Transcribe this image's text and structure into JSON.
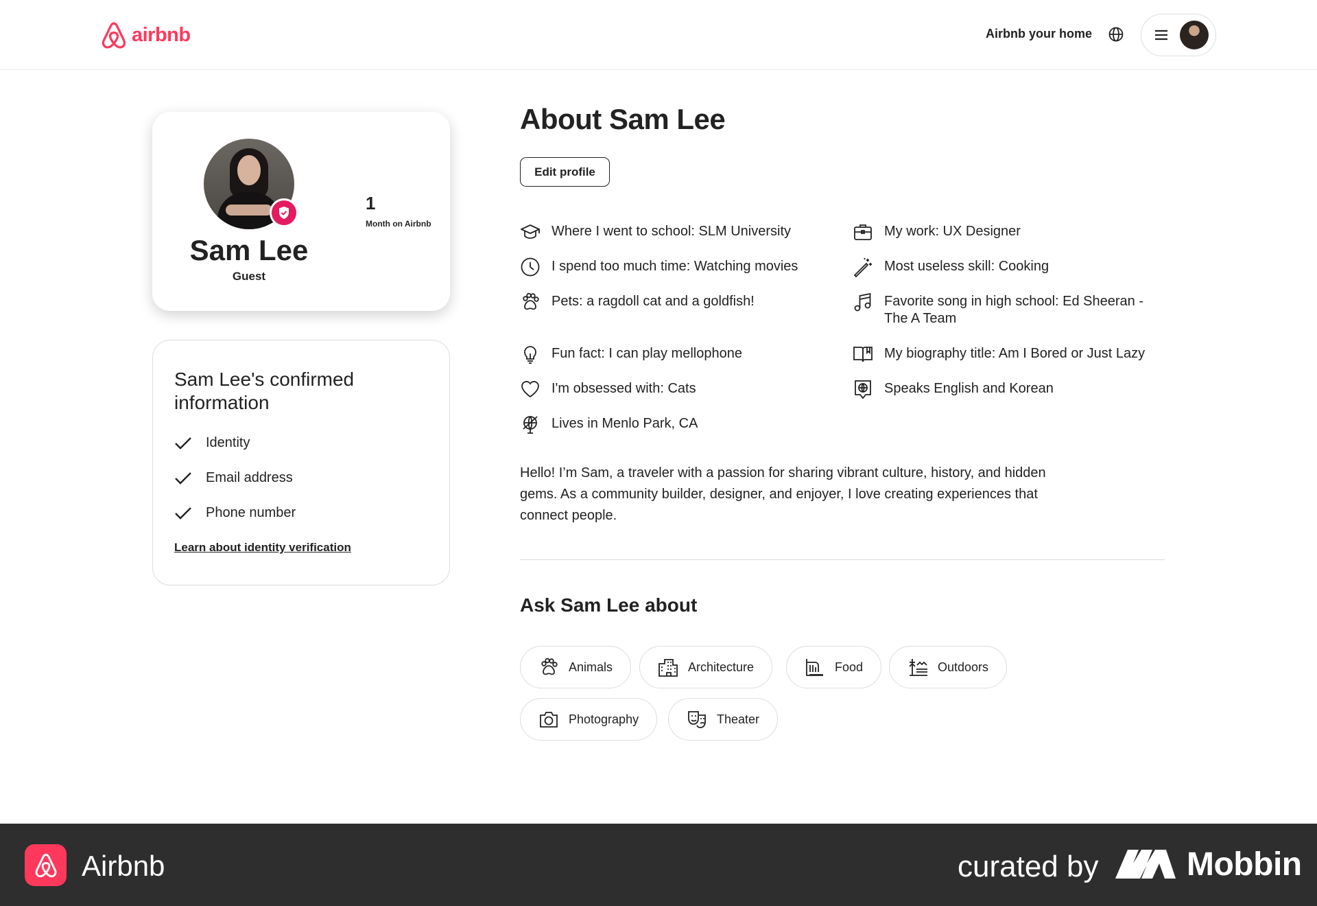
{
  "header": {
    "logo_text": "airbnb",
    "host_link": "Airbnb your home",
    "icons": [
      "airbnb-logo-icon",
      "globe-icon",
      "menu-icon",
      "avatar"
    ]
  },
  "profile": {
    "name": "Sam Lee",
    "role": "Guest",
    "stat_value": "1",
    "stat_label": "Month on Airbnb"
  },
  "confirmed": {
    "title": "Sam Lee's confirmed information",
    "items": [
      "Identity",
      "Email address",
      "Phone number"
    ],
    "link": "Learn about identity verification"
  },
  "about": {
    "title": "About Sam Lee",
    "edit_label": "Edit profile",
    "facts": [
      {
        "icon": "school-icon",
        "text": "Where I went to school: SLM University"
      },
      {
        "icon": "briefcase-icon",
        "text": "My work: UX Designer"
      },
      {
        "icon": "clock-icon",
        "text": "I spend too much time: Watching movies"
      },
      {
        "icon": "magic-wand-icon",
        "text": "Most useless skill: Cooking"
      },
      {
        "icon": "paw-icon",
        "text": "Pets: a ragdoll cat and a goldfish!"
      },
      {
        "icon": "music-note-icon",
        "text": "Favorite song in high school: Ed Sheeran - The A Team"
      },
      {
        "icon": "lightbulb-icon",
        "text": "Fun fact: I can play mellophone"
      },
      {
        "icon": "book-icon",
        "text": "My biography title: Am I Bored or Just Lazy"
      },
      {
        "icon": "heart-icon",
        "text": "I'm obsessed with: Cats"
      },
      {
        "icon": "speech-globe-icon",
        "text": "Speaks English and Korean"
      },
      {
        "icon": "location-globe-icon",
        "text": "Lives in Menlo Park, CA"
      }
    ],
    "bio": "Hello! I’m Sam, a traveler with a passion for sharing vibrant culture, history, and hidden gems. As a community builder, designer, and enjoyer, I love creating experiences that connect people."
  },
  "ask": {
    "title": "Ask Sam Lee about",
    "chips": [
      {
        "icon": "paw-icon",
        "label": "Animals"
      },
      {
        "icon": "building-icon",
        "label": "Architecture"
      },
      {
        "icon": "food-icon",
        "label": "Food"
      },
      {
        "icon": "outdoors-icon",
        "label": "Outdoors"
      },
      {
        "icon": "camera-icon",
        "label": "Photography"
      },
      {
        "icon": "theater-masks-icon",
        "label": "Theater"
      }
    ]
  },
  "footer": {
    "app_name": "Airbnb",
    "curated": "curated by",
    "brand": "Mobbin"
  },
  "colors": {
    "brand": "#ff385c",
    "badge": "#e31c5f",
    "footer_bg": "#2e2e2e",
    "text": "#222222"
  }
}
